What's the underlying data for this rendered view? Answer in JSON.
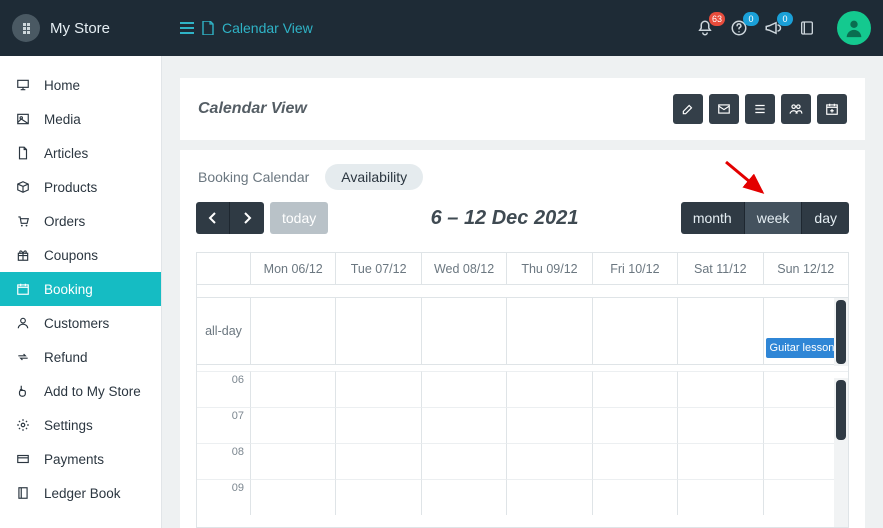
{
  "brand": "My Store",
  "breadcrumb": {
    "label": "Calendar View"
  },
  "notifications": {
    "bell": "63",
    "help": "0",
    "announce": "0"
  },
  "sidebar": {
    "items": [
      {
        "icon": "monitor",
        "label": "Home"
      },
      {
        "icon": "image",
        "label": "Media"
      },
      {
        "icon": "file",
        "label": "Articles"
      },
      {
        "icon": "box",
        "label": "Products"
      },
      {
        "icon": "cart",
        "label": "Orders"
      },
      {
        "icon": "gift",
        "label": "Coupons"
      },
      {
        "icon": "calendar",
        "label": "Booking"
      },
      {
        "icon": "user",
        "label": "Customers"
      },
      {
        "icon": "refund",
        "label": "Refund"
      },
      {
        "icon": "pointer",
        "label": "Add to My Store"
      },
      {
        "icon": "gears",
        "label": "Settings"
      },
      {
        "icon": "card",
        "label": "Payments"
      },
      {
        "icon": "book",
        "label": "Ledger Book"
      }
    ],
    "activeIndex": 6
  },
  "page": {
    "title": "Calendar View",
    "headActions": [
      "compose",
      "mail",
      "list",
      "group",
      "cal-plus"
    ],
    "tabs": {
      "plain": "Booking Calendar",
      "pill": "Availability"
    },
    "toolbar": {
      "today": "today",
      "range": "6 – 12 Dec 2021",
      "views": {
        "month": "month",
        "week": "week",
        "day": "day",
        "active": "week"
      }
    },
    "calendar": {
      "days": [
        "Mon 06/12",
        "Tue 07/12",
        "Wed 08/12",
        "Thu 09/12",
        "Fri 10/12",
        "Sat 11/12",
        "Sun 12/12"
      ],
      "alldayLabel": "all-day",
      "event": {
        "dayIndex": 6,
        "title": "Guitar lessons fo"
      },
      "hours": [
        "06",
        "07",
        "08",
        "09"
      ]
    }
  }
}
